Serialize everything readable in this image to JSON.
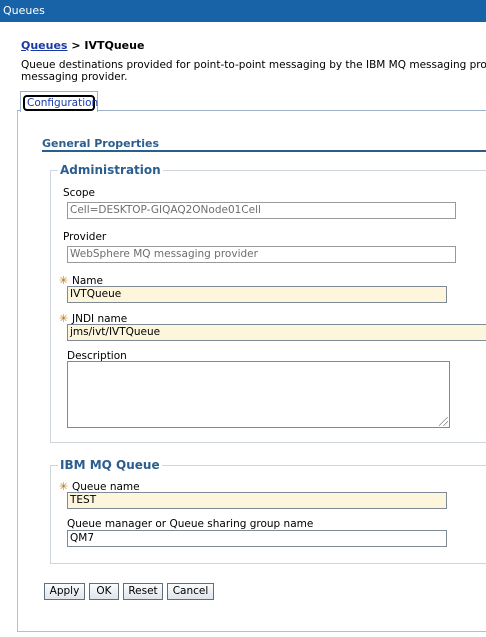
{
  "window": {
    "title": "Queues"
  },
  "breadcrumb": {
    "link": "Queues",
    "separator": ">",
    "current": "IVTQueue"
  },
  "description": {
    "line1": "Queue destinations provided for point-to-point messaging by the IBM MQ messaging provide",
    "line2": "messaging provider."
  },
  "tabs": [
    {
      "label": "Configuration"
    }
  ],
  "general_properties": {
    "title": "General Properties"
  },
  "administration": {
    "legend": "Administration",
    "scope": {
      "label": "Scope",
      "value": "Cell=DESKTOP-GIQAQ2ONode01Cell"
    },
    "provider": {
      "label": "Provider",
      "value": "WebSphere MQ messaging provider"
    },
    "name": {
      "label": "Name",
      "value": "IVTQueue",
      "required_marker": "✳"
    },
    "jndi": {
      "label": "JNDI name",
      "value": "jms/ivt/IVTQueue",
      "required_marker": "✳"
    },
    "description": {
      "label": "Description",
      "value": ""
    }
  },
  "ibm_mq_queue": {
    "legend": "IBM MQ Queue",
    "queue_name": {
      "label": "Queue name",
      "value": "TEST",
      "required_marker": "✳"
    },
    "queue_manager": {
      "label": "Queue manager or Queue sharing group name",
      "value": "QM7"
    }
  },
  "buttons": {
    "apply": "Apply",
    "ok": "OK",
    "reset": "Reset",
    "cancel": "Cancel"
  },
  "colors": {
    "titlebar": "#1862a8",
    "section_heading": "#2b5e8e",
    "link": "#1a39a8",
    "required_field_bg": "#fdf6dd",
    "required_marker": "#c07000"
  }
}
